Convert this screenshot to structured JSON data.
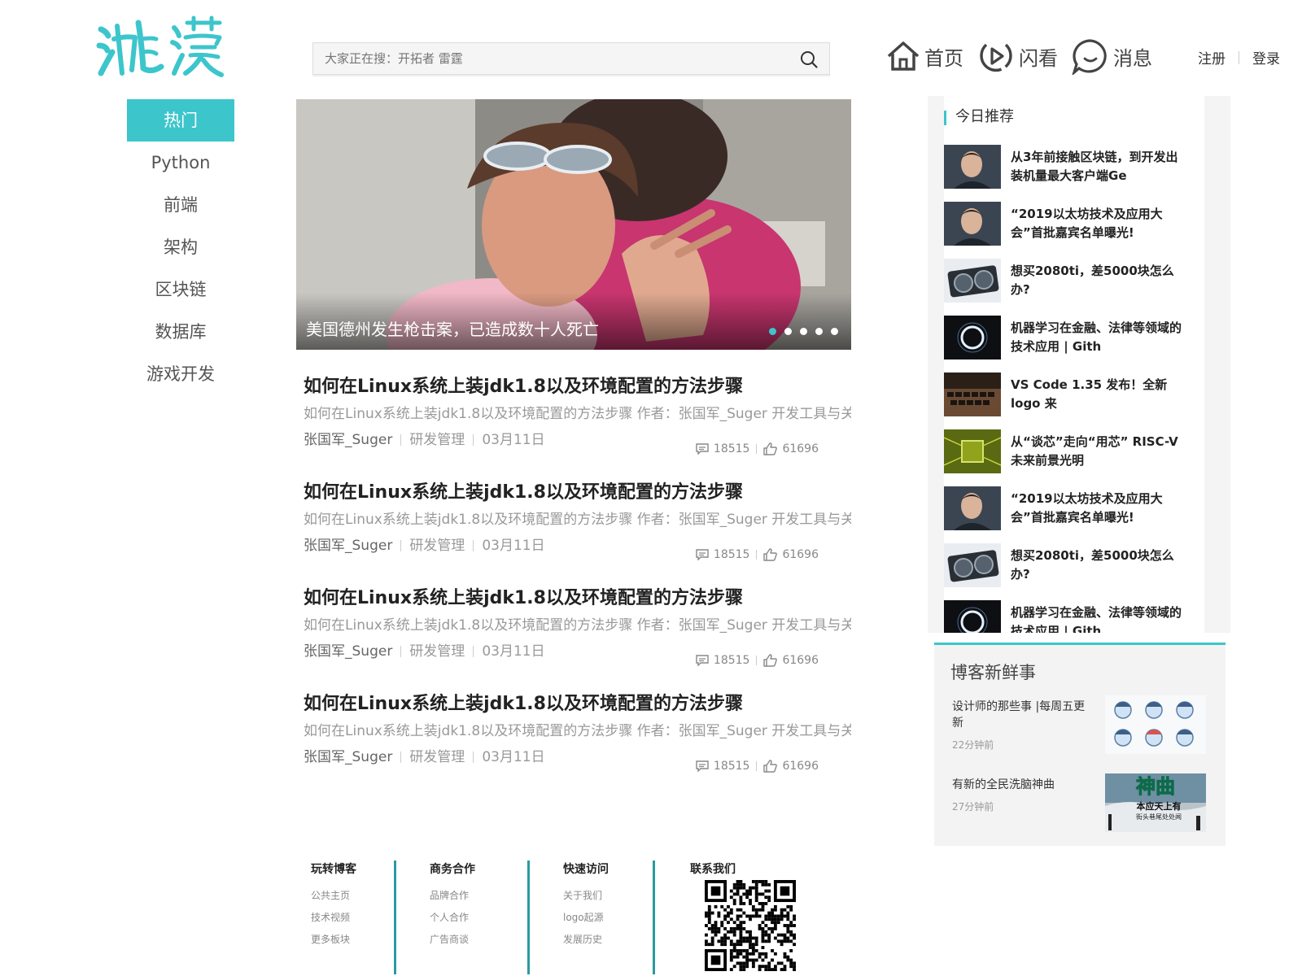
{
  "brand": {
    "logo_text": "鸿蒙",
    "accent": "#3dc5cc"
  },
  "search": {
    "placeholder": "大家正在搜：开拓者 雷霆"
  },
  "nav": {
    "home": "首页",
    "flash": "闪看",
    "messages": "消息"
  },
  "auth": {
    "register": "注册",
    "login": "登录"
  },
  "categories": [
    "热门",
    "Python",
    "前端",
    "架构",
    "区块链",
    "数据库",
    "游戏开发"
  ],
  "banner": {
    "caption": "美国德州发生枪击案，已造成数十人死亡",
    "slide_count": 5,
    "active_slide": 1
  },
  "articles": [
    {
      "title": "如何在Linux系统上装jdk1.8以及环境配置的方法步骤",
      "summary": "如何在Linux系统上装jdk1.8以及环境配置的方法步骤 作者：张国军_Suger 开发工具与关键",
      "author": "张国军_Suger",
      "category": "研发管理",
      "date": "03月11日",
      "comments": "18515",
      "likes": "61696"
    },
    {
      "title": "如何在Linux系统上装jdk1.8以及环境配置的方法步骤",
      "summary": "如何在Linux系统上装jdk1.8以及环境配置的方法步骤 作者：张国军_Suger 开发工具与关键",
      "author": "张国军_Suger",
      "category": "研发管理",
      "date": "03月11日",
      "comments": "18515",
      "likes": "61696"
    },
    {
      "title": "如何在Linux系统上装jdk1.8以及环境配置的方法步骤",
      "summary": "如何在Linux系统上装jdk1.8以及环境配置的方法步骤 作者：张国军_Suger 开发工具与关键",
      "author": "张国军_Suger",
      "category": "研发管理",
      "date": "03月11日",
      "comments": "18515",
      "likes": "61696"
    },
    {
      "title": "如何在Linux系统上装jdk1.8以及环境配置的方法步骤",
      "summary": "如何在Linux系统上装jdk1.8以及环境配置的方法步骤 作者：张国军_Suger 开发工具与关键",
      "author": "张国军_Suger",
      "category": "研发管理",
      "date": "03月11日",
      "comments": "18515",
      "likes": "61696"
    }
  ],
  "recommend": {
    "title": "今日推荐",
    "items": [
      {
        "text": "从3年前接触区块链，到开发出装机量最大客户端Ge",
        "thumb": "person"
      },
      {
        "text": "“2019以太坊技术及应用大会”首批嘉宾名单曝光!",
        "thumb": "person"
      },
      {
        "text": "想买2080ti，差5000块怎么办?",
        "thumb": "gpu"
      },
      {
        "text": "机器学习在金融、法律等领域的技术应用 | Gith",
        "thumb": "ring"
      },
      {
        "text": "VS Code 1.35 发布！全新 logo 来",
        "thumb": "keyboard"
      },
      {
        "text": "从“谈芯”走向“用芯” RISC-V未来前景光明",
        "thumb": "chip"
      },
      {
        "text": "“2019以太坊技术及应用大会”首批嘉宾名单曝光!",
        "thumb": "person"
      },
      {
        "text": "想买2080ti，差5000块怎么办?",
        "thumb": "gpu"
      },
      {
        "text": "机器学习在金融、法律等领域的技术应用 | Gith",
        "thumb": "ring"
      }
    ]
  },
  "news": {
    "title": "博客新鲜事",
    "items": [
      {
        "text": "设计师的那些事 |每周五更新",
        "ago": "22分钟前"
      },
      {
        "text": "有新的全民洗脑神曲",
        "ago": "27分钟前",
        "img_title": "神曲",
        "img_sub1": "本应天上有",
        "img_sub2": "街头巷尾处处闻"
      }
    ]
  },
  "footer": {
    "columns": [
      {
        "title": "玩转博客",
        "links": [
          "公共主页",
          "技术视频",
          "更多板块"
        ]
      },
      {
        "title": "商务合作",
        "links": [
          "品牌合作",
          "个人合作",
          "广告商谈"
        ]
      },
      {
        "title": "快速访问",
        "links": [
          "关于我们",
          "logo起源",
          "发展历史"
        ]
      },
      {
        "title": "联系我们",
        "links": []
      }
    ]
  }
}
